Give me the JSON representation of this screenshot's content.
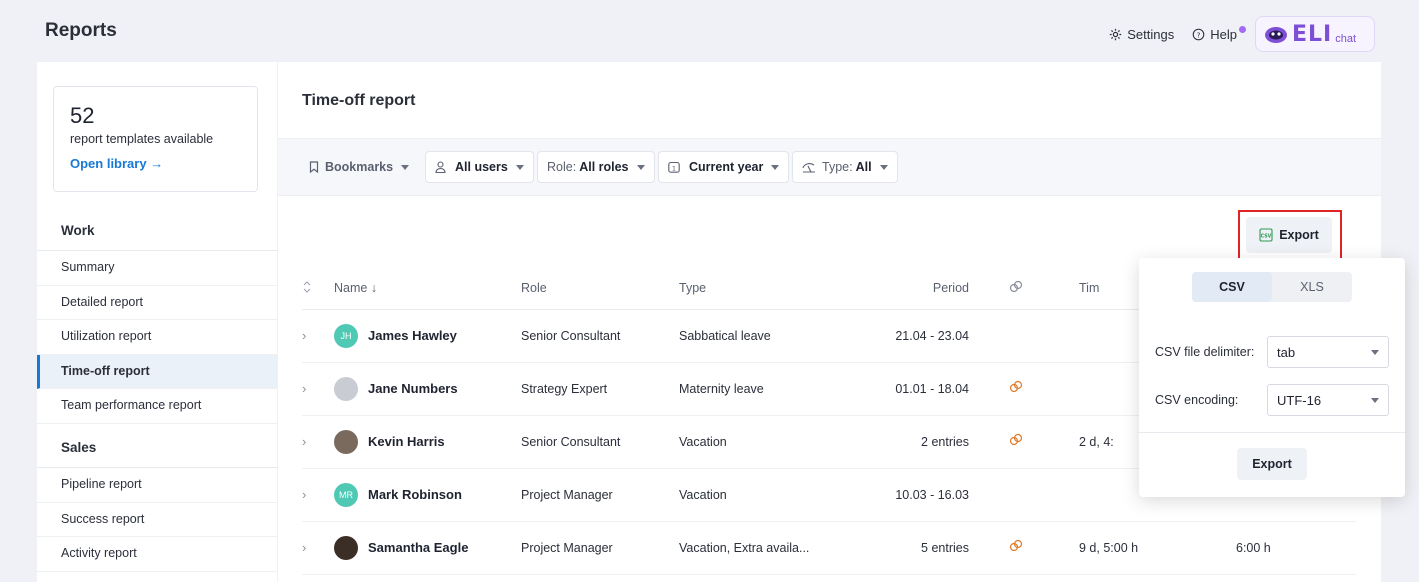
{
  "header": {
    "title": "Reports",
    "settings_label": "Settings",
    "help_label": "Help",
    "eli_word": "ELI",
    "eli_chat": "chat"
  },
  "library": {
    "count": "52",
    "text": "report templates available",
    "link": "Open library →"
  },
  "sidebar": {
    "work_heading": "Work",
    "work_items": [
      "Summary",
      "Detailed report",
      "Utilization report",
      "Time-off report",
      "Team performance report"
    ],
    "active_item": "Time-off report",
    "sales_heading": "Sales",
    "sales_items": [
      "Pipeline report",
      "Success report",
      "Activity report"
    ]
  },
  "main": {
    "title": "Time-off report",
    "filters": {
      "bookmarks": "Bookmarks",
      "users": "All users",
      "role_prefix": "Role:",
      "role_value": "All roles",
      "period": "Current year",
      "type_prefix": "Type:",
      "type_value": "All"
    },
    "export_label": "Export"
  },
  "table": {
    "headers": {
      "name": "Name",
      "role": "Role",
      "type": "Type",
      "period": "Period",
      "time": "Tim"
    },
    "rows": [
      {
        "initials": "JH",
        "name": "James Hawley",
        "role": "Senior Consultant",
        "type": "Sabbatical leave",
        "period": "21.04 - 23.04",
        "linked": false,
        "time": "",
        "extra": ""
      },
      {
        "initials": "",
        "name": "Jane Numbers",
        "role": "Strategy Expert",
        "type": "Maternity leave",
        "period": "01.01 - 18.04",
        "linked": true,
        "time": "",
        "extra": ""
      },
      {
        "initials": "",
        "name": "Kevin Harris",
        "role": "Senior Consultant",
        "type": "Vacation",
        "period": "2 entries",
        "linked": true,
        "time": "2 d, 4:",
        "extra": ""
      },
      {
        "initials": "MR",
        "name": "Mark Robinson",
        "role": "Project Manager",
        "type": "Vacation",
        "period": "10.03 - 16.03",
        "linked": false,
        "time": "",
        "extra": ""
      },
      {
        "initials": "",
        "name": "Samantha Eagle",
        "role": "Project Manager",
        "type": "Vacation, Extra availa...",
        "period": "5 entries",
        "linked": true,
        "time": "9 d, 5:00 h",
        "extra": "6:00 h"
      }
    ]
  },
  "export_menu": {
    "formats": [
      "CSV",
      "XLS"
    ],
    "selected_format": "CSV",
    "delimiter_label": "CSV file delimiter:",
    "delimiter_value": "tab",
    "encoding_label": "CSV encoding:",
    "encoding_value": "UTF-16",
    "export_label": "Export"
  },
  "colors": {
    "accent": "#1878d6",
    "highlight": "#e02424",
    "link_icon": "#e07b2a"
  }
}
